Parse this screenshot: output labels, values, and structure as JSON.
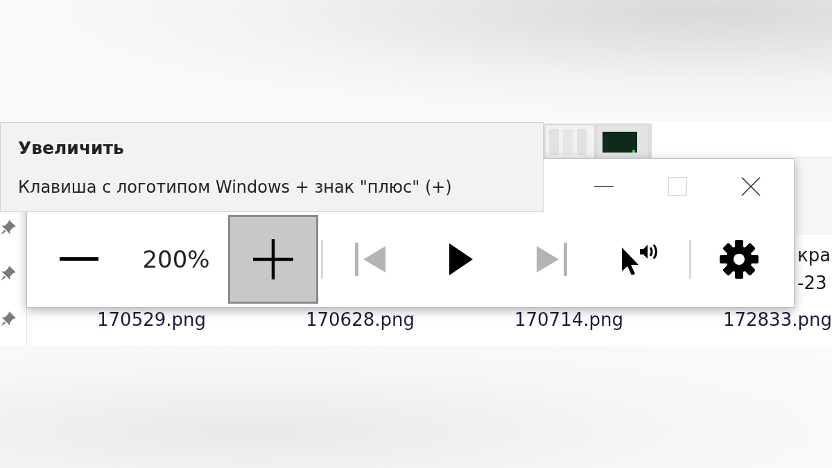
{
  "tooltip": {
    "title": "Увеличить",
    "shortcut": "Клавиша с логотипом Windows + знак \"плюс\" (+)"
  },
  "magnifier": {
    "title_buttons": [
      {
        "kind": "minimize"
      },
      {
        "kind": "maximize",
        "disabled": true
      },
      {
        "kind": "close"
      }
    ],
    "toolbar": [
      {
        "kind": "zoom-out",
        "selected": false,
        "disabled": false
      },
      {
        "kind": "zoom-value",
        "text": "200%"
      },
      {
        "kind": "zoom-in",
        "selected": true,
        "disabled": false
      },
      {
        "kind": "separator"
      },
      {
        "kind": "previous",
        "selected": false,
        "disabled": true
      },
      {
        "kind": "play",
        "selected": false,
        "disabled": false
      },
      {
        "kind": "next",
        "selected": false,
        "disabled": true
      },
      {
        "kind": "read-from-pointer",
        "selected": false,
        "disabled": false
      },
      {
        "kind": "separator"
      },
      {
        "kind": "settings",
        "selected": false,
        "disabled": false
      }
    ]
  },
  "explorer": {
    "pinned_count_icons": [
      {
        "kind": "pin"
      },
      {
        "kind": "pin"
      },
      {
        "kind": "pin"
      }
    ],
    "side_text": [
      "кра",
      "-23"
    ],
    "file_names": [
      "170529.png",
      "170628.png",
      "170714.png",
      "172833.png"
    ]
  }
}
